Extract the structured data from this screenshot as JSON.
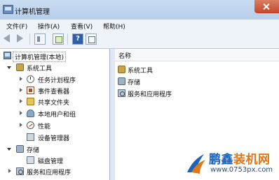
{
  "window": {
    "title": "计算机管理"
  },
  "menubar": {
    "items": [
      "文件(F)",
      "操作(A)",
      "查看(V)",
      "帮助(H)"
    ]
  },
  "toolbar": {
    "buttons": [
      "back-arrow-icon",
      "forward-arrow-icon",
      "show-hide-pane-icon",
      "export-list-icon",
      "help-icon",
      "view-icon"
    ],
    "help_glyph": "?"
  },
  "tree": {
    "root": "计算机管理(本地)",
    "items": [
      {
        "label": "系统工具",
        "icon": "tools-icon"
      },
      {
        "label": "任务计划程序",
        "icon": "clock-icon"
      },
      {
        "label": "事件查看器",
        "icon": "event-viewer-icon"
      },
      {
        "label": "共享文件夹",
        "icon": "shared-folder-icon"
      },
      {
        "label": "本地用户和组",
        "icon": "users-icon"
      },
      {
        "label": "性能",
        "icon": "performance-icon"
      },
      {
        "label": "设备管理器",
        "icon": "device-manager-icon"
      },
      {
        "label": "存储",
        "icon": "storage-icon"
      },
      {
        "label": "磁盘管理",
        "icon": "disk-icon"
      },
      {
        "label": "服务和应用程序",
        "icon": "services-icon"
      }
    ]
  },
  "content": {
    "column_header": "名称",
    "items": [
      {
        "label": "系统工具",
        "icon": "tools-icon"
      },
      {
        "label": "存储",
        "icon": "storage-icon"
      },
      {
        "label": "服务和应用程序",
        "icon": "services-icon"
      }
    ]
  },
  "watermark": {
    "title_part1": "鹏鑫",
    "title_part2": "装机网",
    "url": "www.0753px.com"
  },
  "colors": {
    "title_bar": "#c9dcf1",
    "close_button": "#c5432a",
    "watermark_blue": "#1f63b8",
    "watermark_orange": "#e0761a"
  }
}
